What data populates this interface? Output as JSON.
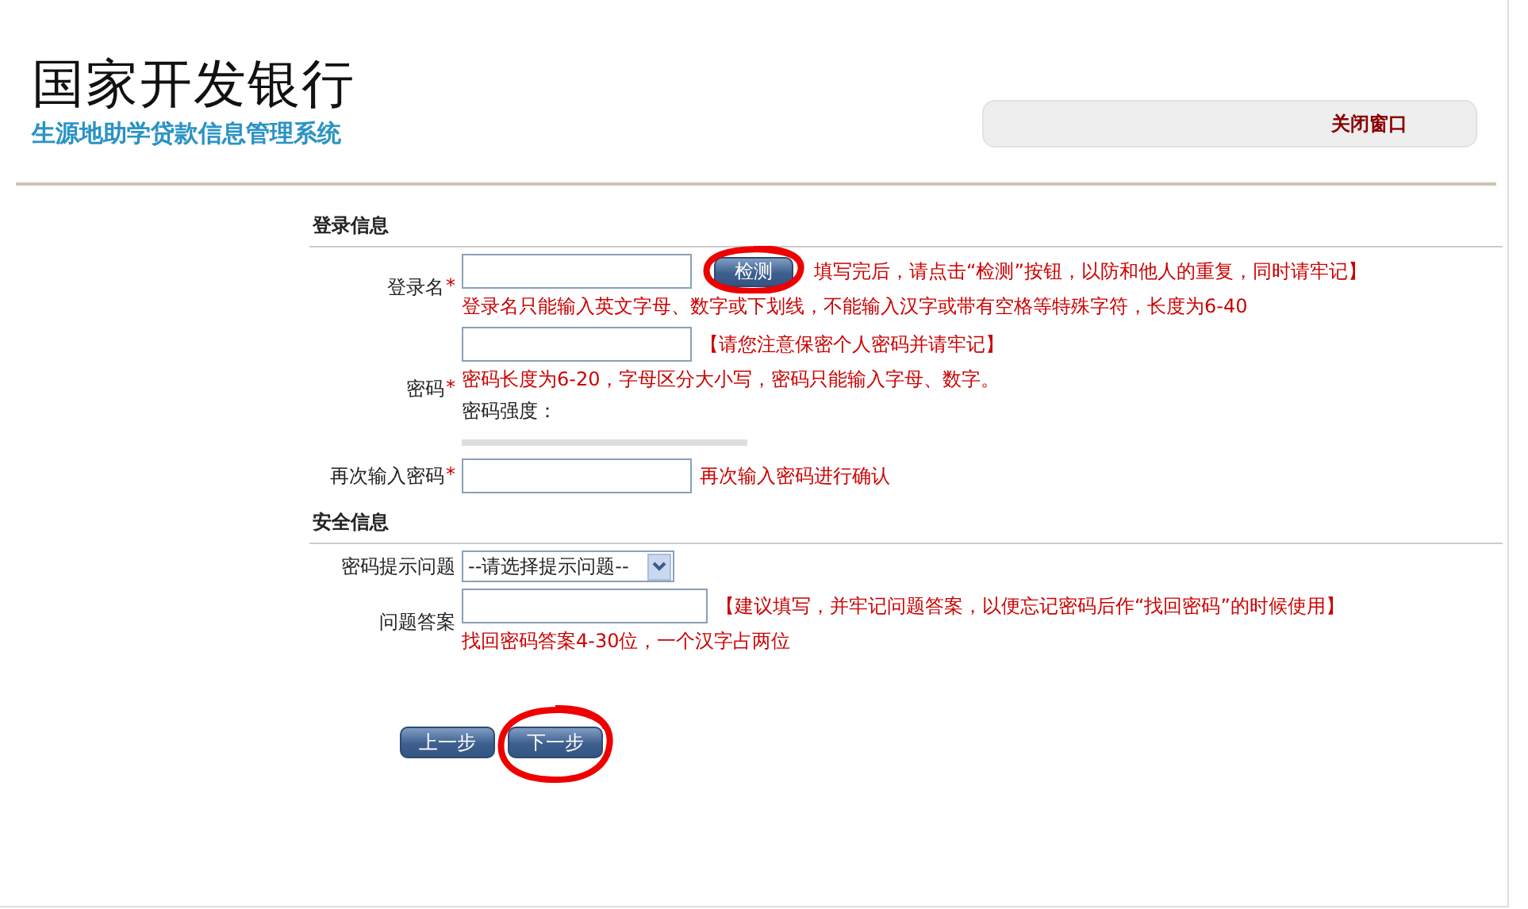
{
  "header": {
    "title": "国家开发银行",
    "subtitle": "生源地助学贷款信息管理系统",
    "close_link": "关闭窗口"
  },
  "sections": [
    {
      "heading": "登录信息",
      "fields": [
        {
          "kind": "text",
          "label": "登录名",
          "required_mark": "*",
          "button": {
            "label": "检测",
            "highlighted": true
          },
          "hint": "填写完后，请点击“检测”按钮，以防和他人的重复，同时请牢记】",
          "note": "登录名只能输入英文字母、数字或下划线，不能输入汉字或带有空格等特殊字符，长度为6-40"
        },
        {
          "kind": "password",
          "label": "密码",
          "required_mark": "*",
          "hint": "【请您注意保密个人密码并请牢记】",
          "note": "密码长度为6-20，字母区分大小写，密码只能输入字母、数字。",
          "strength_label": "密码强度："
        },
        {
          "kind": "text",
          "label": "再次输入密码",
          "required_mark": "*",
          "hint": "再次输入密码进行确认"
        }
      ]
    },
    {
      "heading": "安全信息",
      "fields": [
        {
          "kind": "select",
          "label": "密码提示问题",
          "value": "--请选择提示问题--"
        },
        {
          "kind": "text",
          "label": "问题答案",
          "hint": "【建议填写，并牢记问题答案，以便忘记密码后作“找回密码”的时候使用】",
          "note": "找回密码答案4-30位，一个汉字占两位"
        }
      ]
    }
  ],
  "buttons": [
    {
      "label": "上一步",
      "highlighted": false
    },
    {
      "label": "下一步",
      "highlighted": true
    }
  ]
}
